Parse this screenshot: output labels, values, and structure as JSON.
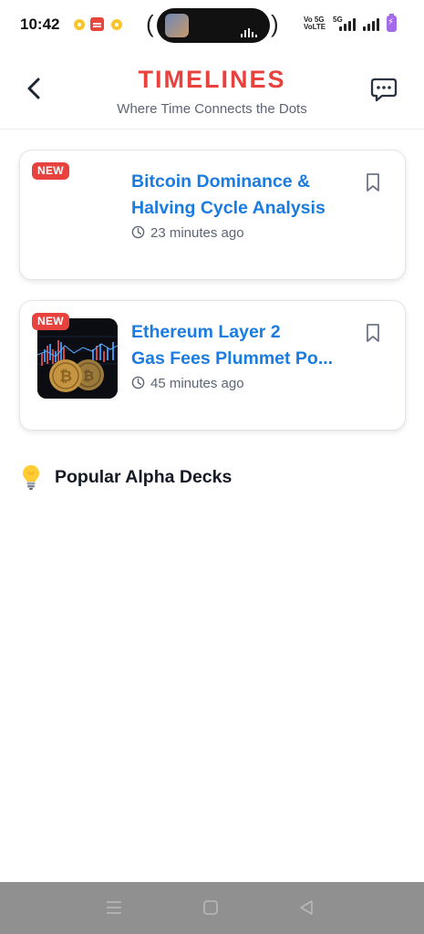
{
  "status_bar": {
    "time": "10:42",
    "network_line1": "Vo 5G",
    "network_line2": "VoLTE",
    "network_badge": "5G",
    "battery_color": "#a36bea"
  },
  "header": {
    "back_icon": "chevron-left-icon",
    "brand": "TIMELINES",
    "tagline": "Where Time Connects the Dots",
    "chat_icon": "chat-bubble-icon",
    "brand_color": "#e8423f"
  },
  "cards": [
    {
      "badge": "NEW",
      "title_line1": "Bitcoin Dominance &",
      "title_line2": "Halving Cycle Analysis",
      "time": "23 minutes ago",
      "has_image": false
    },
    {
      "badge": "NEW",
      "title_line1": "Ethereum Layer 2",
      "title_line2": "Gas Fees Plummet Po...",
      "time": "45 minutes ago",
      "has_image": true,
      "image": "bitcoin-coins-chart-image"
    }
  ],
  "section": {
    "icon": "lightbulb-icon",
    "title": "Popular Alpha Decks"
  },
  "nav_bar": {
    "items": [
      "menu-icon",
      "home-square-icon",
      "back-triangle-icon"
    ]
  },
  "colors": {
    "accent_blue": "#1a7be0",
    "badge_red": "#e8423f",
    "muted_text": "#5d6575"
  }
}
